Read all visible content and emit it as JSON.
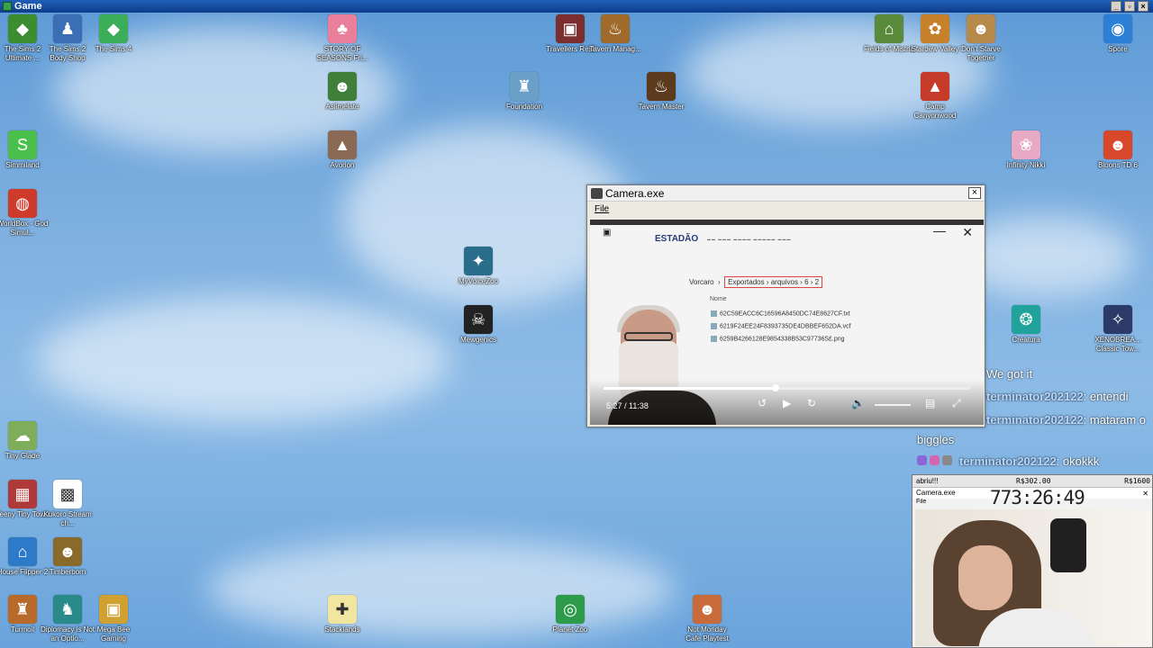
{
  "window": {
    "title": "Game"
  },
  "desktop_icons": [
    {
      "label": "The Sims 2 Ultimate ...",
      "color": "#3c8d2f",
      "glyph": "◆"
    },
    {
      "label": "The Sims 2 Body Shop",
      "color": "#3b6fb5",
      "glyph": "♟"
    },
    {
      "label": "The Sims 4",
      "color": "#3cae5a",
      "glyph": "◆"
    },
    {
      "label": "STORY OF SEASONS Fri...",
      "color": "#e97f9b",
      "glyph": "♣"
    },
    {
      "label": "Travellers Rest",
      "color": "#7a2e2e",
      "glyph": "▣"
    },
    {
      "label": "Tavern Manag...",
      "color": "#a06a2a",
      "glyph": "♨"
    },
    {
      "label": "Fields of Mistria",
      "color": "#5a8a3c",
      "glyph": "⌂"
    },
    {
      "label": "Stardew Valley",
      "color": "#c8812b",
      "glyph": "✿"
    },
    {
      "label": "Don't Starve Together",
      "color": "#b88a4a",
      "glyph": "☻"
    },
    {
      "label": "Spore",
      "color": "#2b7fd6",
      "glyph": "◉"
    },
    {
      "label": "Aslimelate",
      "color": "#3f7f3a",
      "glyph": "☻"
    },
    {
      "label": "Foundation",
      "color": "#6aa0c8",
      "glyph": "♜"
    },
    {
      "label": "Tavern Master",
      "color": "#5b3a1e",
      "glyph": "♨"
    },
    {
      "label": "Camp Canyonwood",
      "color": "#c63a2a",
      "glyph": "▲"
    },
    {
      "label": "Simmiland",
      "color": "#4bbf4b",
      "glyph": "S"
    },
    {
      "label": "Avorion",
      "color": "#8a6a55",
      "glyph": "▲"
    },
    {
      "label": "Infinity Nikki",
      "color": "#e8a9c5",
      "glyph": "❀"
    },
    {
      "label": "Bloons TD 6",
      "color": "#d9472b",
      "glyph": "☻"
    },
    {
      "label": "WorldBox - God Simul...",
      "color": "#cf3b2b",
      "glyph": "◍"
    },
    {
      "label": "MyVoiceZoo",
      "color": "#2a6d8a",
      "glyph": "✦"
    },
    {
      "label": "Mewgenics",
      "color": "#222222",
      "glyph": "☠"
    },
    {
      "label": "Creatura",
      "color": "#1fa39a",
      "glyph": "❂"
    },
    {
      "label": "XENOBREA... Classic Tow...",
      "color": "#2c3a6a",
      "glyph": "✧"
    },
    {
      "label": "Tiny Glade",
      "color": "#7fae5a",
      "glyph": "☁"
    },
    {
      "label": "Teeny Tiny Town",
      "color": "#b03a3a",
      "glyph": "▦"
    },
    {
      "label": "Kukoro Stream ch...",
      "color": "#ffffff",
      "glyph": "▩"
    },
    {
      "label": "House Flipper 2",
      "color": "#2d7ac9",
      "glyph": "⌂"
    },
    {
      "label": "Timberborn",
      "color": "#8a6a2a",
      "glyph": "☻"
    },
    {
      "label": "Turmoil",
      "color": "#b86a2a",
      "glyph": "♜"
    },
    {
      "label": "Diplomacy is Not an Optio...",
      "color": "#2a8a8a",
      "glyph": "♞"
    },
    {
      "label": "Mega Bee Gaming",
      "color": "#d0a030",
      "glyph": "▣"
    },
    {
      "label": "Stacklands",
      "color": "#f0e6a0",
      "glyph": "✚"
    },
    {
      "label": "Planet Zoo",
      "color": "#2e9b4a",
      "glyph": "◎"
    },
    {
      "label": "Not Monday Cafe Playtest",
      "color": "#c86a3a",
      "glyph": "☻"
    }
  ],
  "camera_window": {
    "title": "Camera.exe",
    "menu_file": "File",
    "video": {
      "logo": "ESTADÃO",
      "breadcrumb_root": "Vorcaro",
      "breadcrumb_path": "Exportados  ›  arquivos  ›  6  ›  2",
      "column_header": "Nome",
      "files": [
        "62C59EACC6C16596A8450DC74E8627CF.txt",
        "6219F24EE24F8393735DE4DBBEF652DA.vcf",
        "6259B4266128E9854338B53C97736S£.png"
      ],
      "time_label": "5:27 / 11:38",
      "progress": 0.469
    }
  },
  "chat": [
    {
      "user": "",
      "text": "We got it"
    },
    {
      "user": "terminator202122",
      "text": ": entendi"
    },
    {
      "user": "terminator202122",
      "text": ": mataram o"
    },
    {
      "user": "",
      "text": "biggles"
    },
    {
      "user": "terminator202122",
      "text": ": okokkk"
    }
  ],
  "overlay": {
    "label": "abriu!!!",
    "price_1": "R$302.00",
    "price_2": "R$1600",
    "window_title": "Camera.exe",
    "timer": "773:26:49",
    "menu_file": "File"
  }
}
